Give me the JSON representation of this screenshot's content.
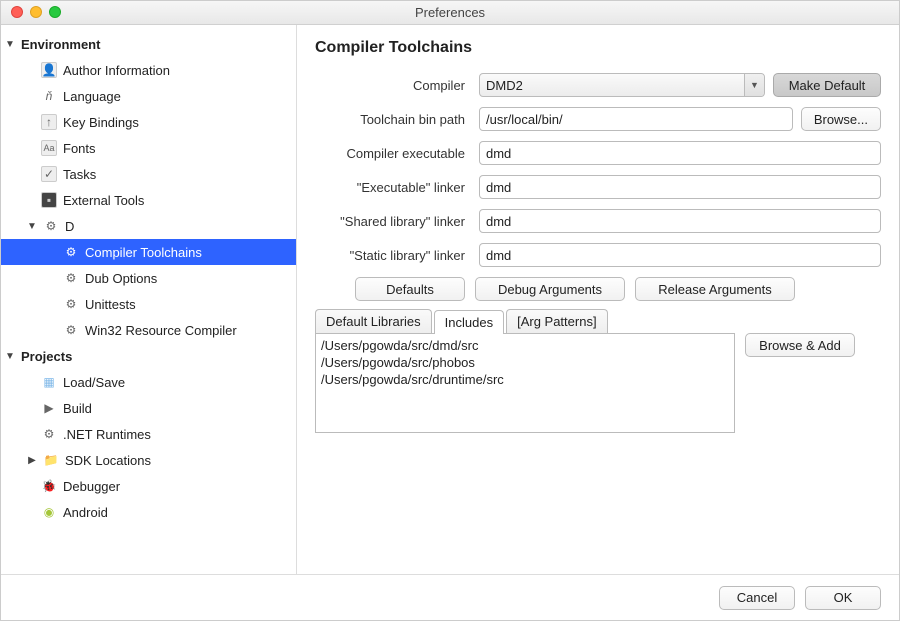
{
  "window": {
    "title": "Preferences"
  },
  "sidebar": {
    "environment": {
      "label": "Environment",
      "items": [
        {
          "label": "Author Information"
        },
        {
          "label": "Language"
        },
        {
          "label": "Key Bindings"
        },
        {
          "label": "Fonts"
        },
        {
          "label": "Tasks"
        },
        {
          "label": "External Tools"
        }
      ],
      "d": {
        "label": "D",
        "items": [
          {
            "label": "Compiler Toolchains"
          },
          {
            "label": "Dub Options"
          },
          {
            "label": "Unittests"
          },
          {
            "label": "Win32 Resource Compiler"
          }
        ]
      }
    },
    "projects": {
      "label": "Projects",
      "items": [
        {
          "label": "Load/Save"
        },
        {
          "label": "Build"
        },
        {
          "label": ".NET Runtimes"
        },
        {
          "label": "SDK Locations"
        },
        {
          "label": "Debugger"
        },
        {
          "label": "Android"
        }
      ]
    }
  },
  "panel": {
    "heading": "Compiler Toolchains",
    "labels": {
      "compiler": "Compiler",
      "bin_path": "Toolchain bin path",
      "compiler_exec": "Compiler executable",
      "exec_linker": "\"Executable\" linker",
      "shared_linker": "\"Shared library\" linker",
      "static_linker": "\"Static library\" linker"
    },
    "values": {
      "compiler": "DMD2",
      "bin_path": "/usr/local/bin/",
      "compiler_exec": "dmd",
      "exec_linker": "dmd",
      "shared_linker": "dmd",
      "static_linker": "dmd"
    },
    "buttons": {
      "make_default": "Make Default",
      "browse": "Browse...",
      "defaults": "Defaults",
      "debug_args": "Debug Arguments",
      "release_args": "Release Arguments",
      "browse_add": "Browse & Add"
    },
    "tabs": {
      "default_libs": "Default Libraries",
      "includes": "Includes",
      "arg_patterns": "[Arg Patterns]"
    },
    "includes_list": [
      "/Users/pgowda/src/dmd/src",
      "/Users/pgowda/src/phobos",
      "/Users/pgowda/src/druntime/src"
    ]
  },
  "footer": {
    "cancel": "Cancel",
    "ok": "OK"
  }
}
